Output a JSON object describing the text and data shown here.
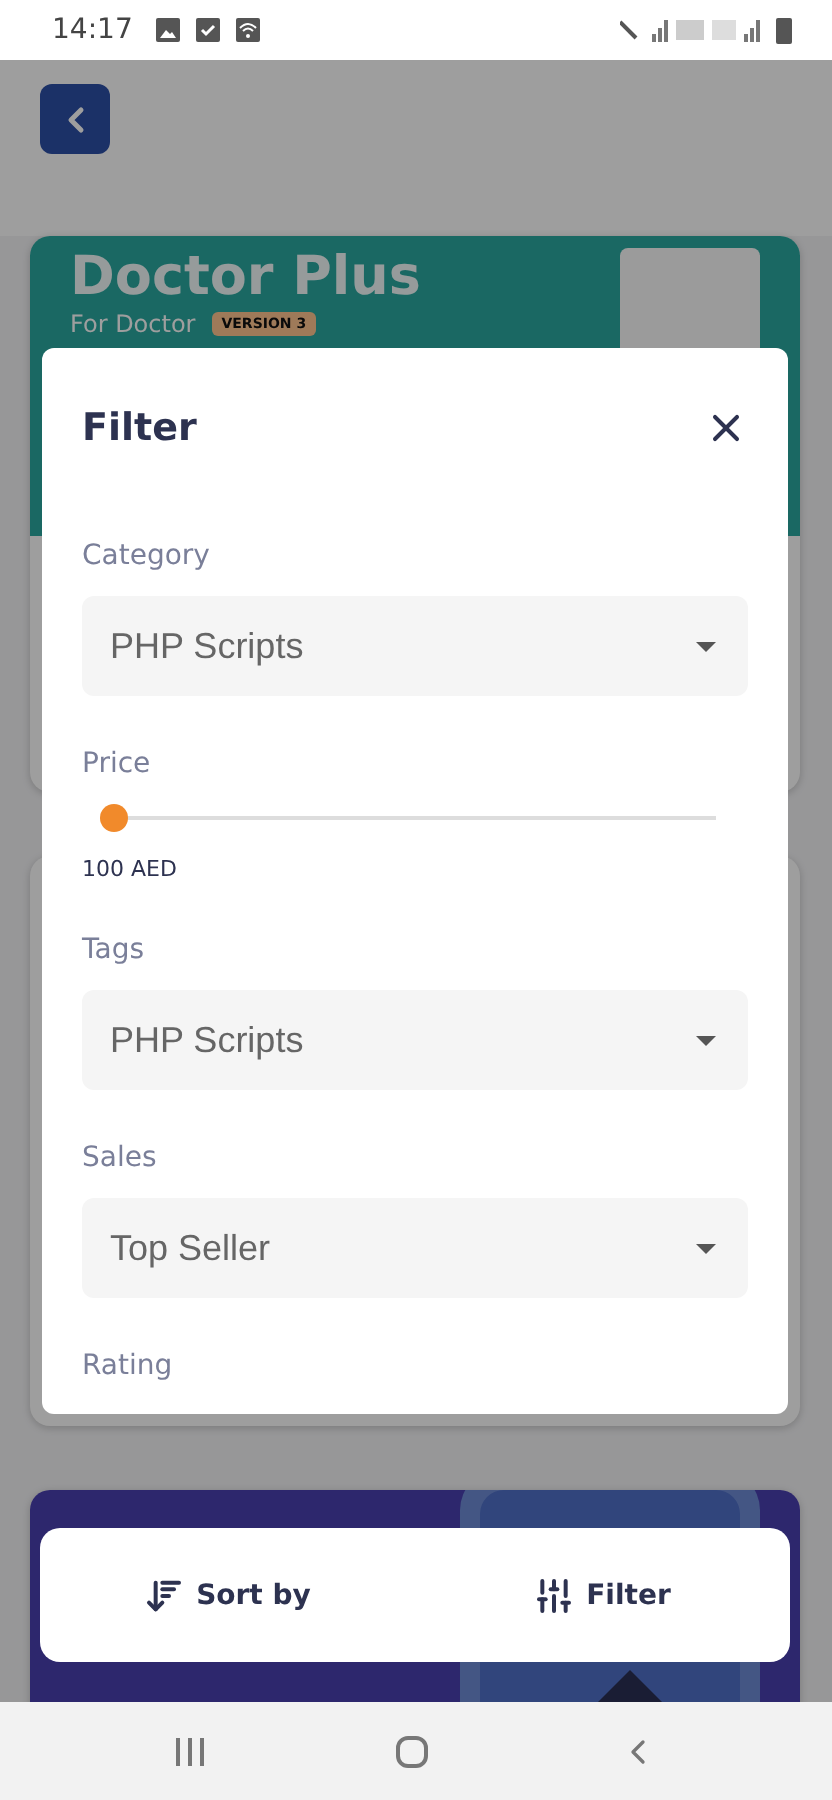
{
  "status_bar": {
    "time": "14:17"
  },
  "background": {
    "cards": [
      {
        "kind": "teal",
        "title": "Doctor Plus",
        "subtitle": "For Doctor",
        "badge": "VERSION 3"
      },
      {
        "kind": "plain"
      },
      {
        "kind": "purple"
      }
    ]
  },
  "filter_dialog": {
    "title": "Filter",
    "sections": [
      {
        "kind": "dropdown",
        "label": "Category",
        "value": "PHP Scripts"
      },
      {
        "kind": "slider",
        "label": "Price",
        "level": 0,
        "reading": "100 AED"
      },
      {
        "kind": "dropdown",
        "label": "Tags",
        "value": "PHP Scripts"
      },
      {
        "kind": "dropdown",
        "label": "Sales",
        "value": "Top Seller"
      },
      {
        "kind": "heading",
        "label": "Rating"
      }
    ]
  },
  "bottom_bar": {
    "buttons": [
      {
        "kind": "sort",
        "label": "Sort by"
      },
      {
        "kind": "filter",
        "label": "Filter"
      }
    ]
  }
}
